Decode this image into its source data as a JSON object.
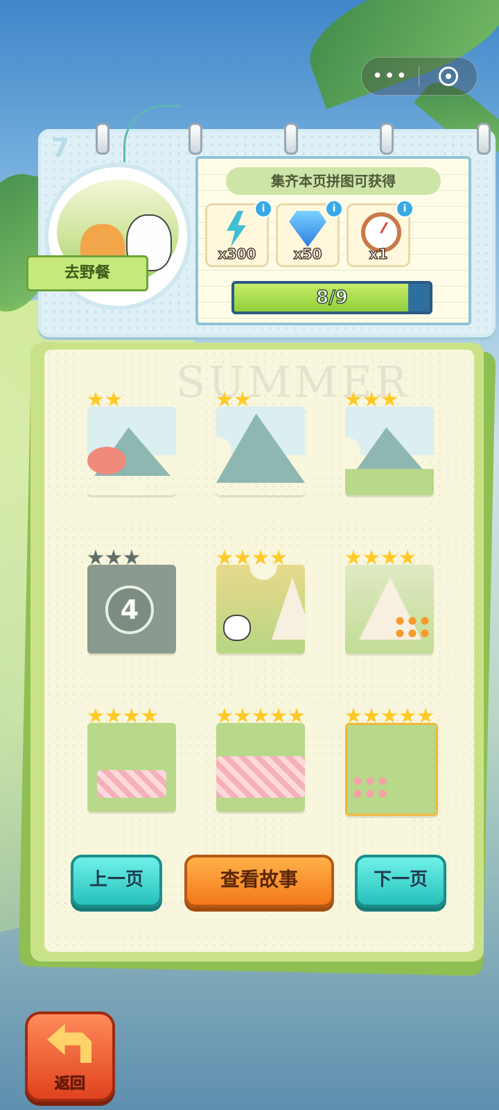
{
  "capsule": {
    "more_icon": "more-dots-icon",
    "target_icon": "target-icon"
  },
  "header": {
    "page_number": "7",
    "badge_label": "去野餐",
    "reward_title": "集齐本页拼图可获得",
    "rewards": [
      {
        "icon": "lightning-energy-icon",
        "qty": "x300"
      },
      {
        "icon": "diamond-gem-icon",
        "qty": "x50"
      },
      {
        "icon": "alarm-clock-icon",
        "qty": "x1"
      }
    ],
    "progress": {
      "text": "8/9",
      "current": 8,
      "total": 9
    }
  },
  "book": {
    "watermark": "SUMMER",
    "pieces": [
      {
        "stars": 2,
        "stars_filled": 2,
        "unlocked": true
      },
      {
        "stars": 2,
        "stars_filled": 2,
        "unlocked": true
      },
      {
        "stars": 3,
        "stars_filled": 3,
        "unlocked": true
      },
      {
        "stars": 3,
        "stars_filled": 0,
        "unlocked": false,
        "number": "4"
      },
      {
        "stars": 4,
        "stars_filled": 4,
        "unlocked": true
      },
      {
        "stars": 4,
        "stars_filled": 4,
        "unlocked": true
      },
      {
        "stars": 4,
        "stars_filled": 4,
        "unlocked": true
      },
      {
        "stars": 5,
        "stars_filled": 5,
        "unlocked": true
      },
      {
        "stars": 5,
        "stars_filled": 5,
        "unlocked": true
      }
    ]
  },
  "buttons": {
    "prev_page": "上一页",
    "view_story": "查看故事",
    "next_page": "下一页",
    "back": "返回"
  },
  "colors": {
    "accent_teal": "#27c1bb",
    "accent_orange": "#f5791a",
    "star": "#ffc928"
  }
}
